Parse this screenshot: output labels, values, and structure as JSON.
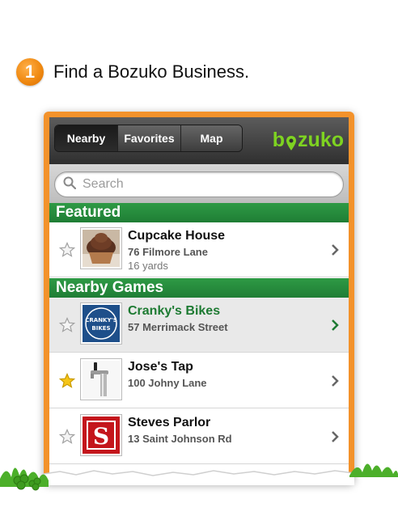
{
  "step": {
    "number": "1",
    "text": "Find a Bozuko Business."
  },
  "navbar": {
    "tabs": [
      {
        "label": "Nearby",
        "active": true
      },
      {
        "label": "Favorites",
        "active": false
      },
      {
        "label": "Map",
        "active": false
      }
    ],
    "logo_text": "bozuko"
  },
  "search": {
    "placeholder": "Search"
  },
  "sections": {
    "featured": "Featured",
    "nearby_games": "Nearby Games"
  },
  "featured_items": [
    {
      "name": "Cupcake House",
      "address": "76 Filmore Lane",
      "distance": "16 yards",
      "favorite": false
    }
  ],
  "nearby_items": [
    {
      "name": "Cranky's Bikes",
      "address": "57 Merrimack Street",
      "favorite": false,
      "selected": true,
      "thumb_text": "CRANKY'S BIKES"
    },
    {
      "name": "Jose's Tap",
      "address": "100 Johny Lane",
      "favorite": true,
      "selected": false
    },
    {
      "name": "Steves Parlor",
      "address": "13 Saint Johnson Rd",
      "favorite": false,
      "selected": false,
      "thumb_text": "S"
    }
  ],
  "colors": {
    "accent_orange": "#f3922b",
    "section_green": "#1f7d35",
    "logo_green": "#7ed321",
    "star_gold": "#f5c518"
  }
}
